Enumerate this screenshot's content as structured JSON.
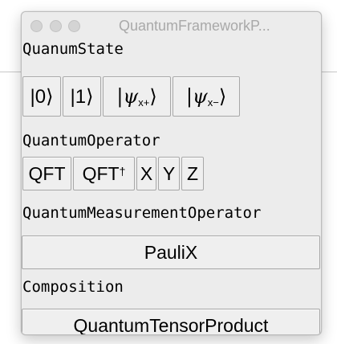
{
  "window": {
    "title": "QuantumFrameworkP..."
  },
  "state_section": {
    "label": "QuanumState",
    "buttons": [
      {
        "label": "|0⟩"
      },
      {
        "label": "|1⟩"
      },
      {
        "label_prefix": "|ψ",
        "sub": "x+",
        "label_suffix": "⟩"
      },
      {
        "label_prefix": "|ψ",
        "sub": "x−",
        "label_suffix": "⟩"
      }
    ]
  },
  "operator_section": {
    "label": "QuantumOperator",
    "buttons": [
      {
        "label": "QFT"
      },
      {
        "label": "QFT",
        "sup": "†"
      },
      {
        "label": "X"
      },
      {
        "label": "Y"
      },
      {
        "label": "Z"
      }
    ]
  },
  "measurement_section": {
    "label": "QuantumMeasurementOperator",
    "button_label": "PauliX"
  },
  "composition_section": {
    "label": "Composition",
    "button_label": "QuantumTensorProduct"
  }
}
